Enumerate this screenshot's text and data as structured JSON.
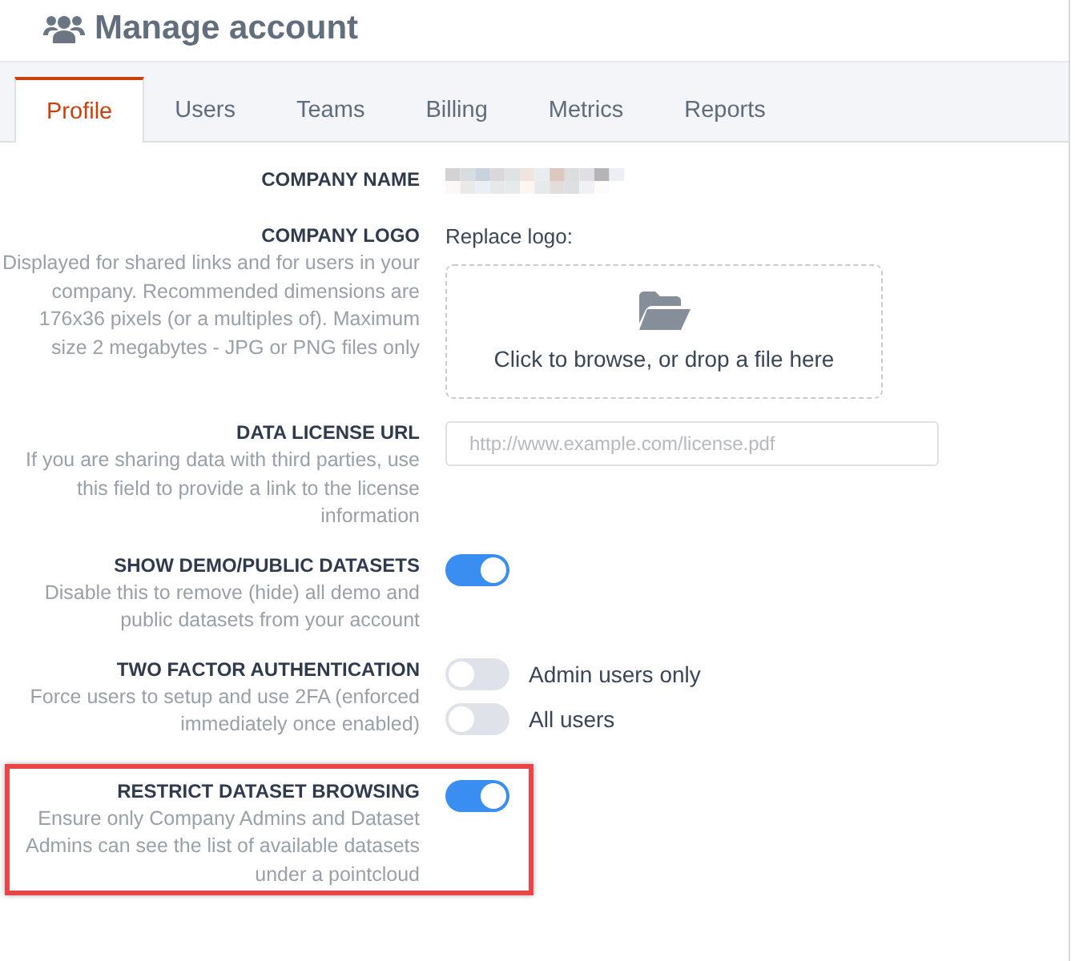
{
  "page": {
    "title": "Manage account"
  },
  "tabs": [
    {
      "label": "Profile",
      "selected": true
    },
    {
      "label": "Users",
      "selected": false
    },
    {
      "label": "Teams",
      "selected": false
    },
    {
      "label": "Billing",
      "selected": false
    },
    {
      "label": "Metrics",
      "selected": false
    },
    {
      "label": "Reports",
      "selected": false
    }
  ],
  "settings": [
    {
      "kind": "redacted",
      "label": "COMPANY NAME",
      "highlighted": false
    },
    {
      "kind": "upload",
      "label": "COMPANY LOGO",
      "description": "Displayed for shared links and for users in your company. Recommended dimensions are 176x36 pixels (or a multiples of). Maximum size 2 megabytes - JPG or PNG files only",
      "caption": "Replace logo:",
      "drop_text": "Click to browse, or drop a file here",
      "highlighted": false
    },
    {
      "kind": "url",
      "label": "DATA LICENSE URL",
      "description": "If you are sharing data with third parties, use this field to provide a link to the license information",
      "placeholder": "http://www.example.com/license.pdf",
      "highlighted": false
    },
    {
      "kind": "toggle",
      "label": "SHOW DEMO/PUBLIC DATASETS",
      "description": "Disable this to remove (hide) all demo and public datasets from your account",
      "on": true,
      "highlighted": false
    },
    {
      "kind": "toggles",
      "label": "TWO FACTOR AUTHENTICATION",
      "description": "Force users to setup and use 2FA (enforced immediately once enabled)",
      "options": [
        {
          "label": "Admin users only",
          "on": false
        },
        {
          "label": "All users",
          "on": false
        }
      ],
      "highlighted": false
    },
    {
      "kind": "toggle",
      "label": "RESTRICT DATASET BROWSING",
      "description": "Ensure only Company Admins and Dataset Admins can see the list of available datasets under a pointcloud",
      "on": true,
      "highlighted": true
    }
  ]
}
